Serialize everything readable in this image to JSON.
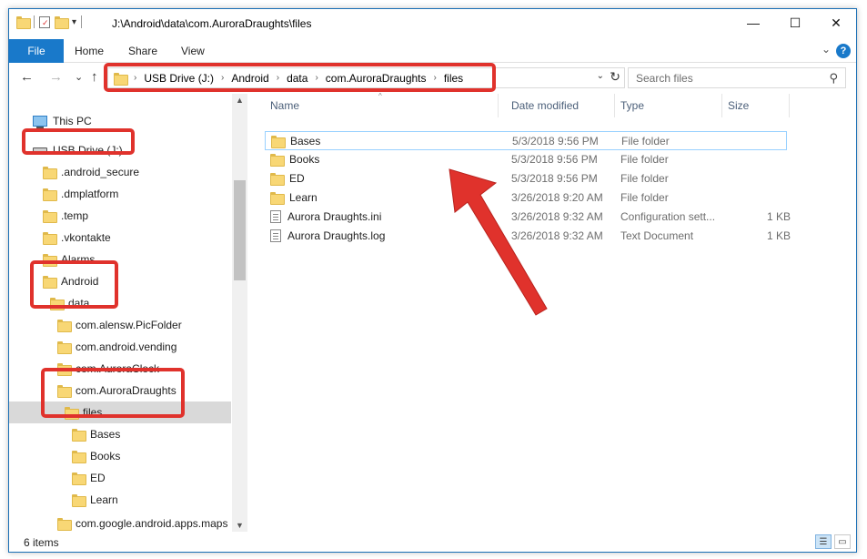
{
  "window": {
    "title": "J:\\Android\\data\\com.AuroraDraughts\\files",
    "minimize": "—",
    "maximize": "☐",
    "close": "✕"
  },
  "ribbon": {
    "tabs": [
      "File",
      "Home",
      "Share",
      "View"
    ],
    "help": "?"
  },
  "nav": {
    "back": "←",
    "forward": "→",
    "recent": "⌄",
    "up": "↑",
    "breadcrumbs": [
      "USB Drive (J:)",
      "Android",
      "data",
      "com.AuroraDraughts",
      "files"
    ],
    "search_placeholder": "Search files"
  },
  "tree": [
    {
      "label": "This PC",
      "icon": "pc-icon"
    },
    {
      "label": "USB Drive (J:)",
      "icon": "drive-icon"
    },
    {
      "label": ".android_secure",
      "icon": "folder-icon"
    },
    {
      "label": ".dmplatform",
      "icon": "folder-icon"
    },
    {
      "label": ".temp",
      "icon": "folder-icon"
    },
    {
      "label": ".vkontakte",
      "icon": "folder-icon"
    },
    {
      "label": "Alarms",
      "icon": "folder-icon"
    },
    {
      "label": "Android",
      "icon": "folder-icon"
    },
    {
      "label": "data",
      "icon": "folder-icon"
    },
    {
      "label": "com.alensw.PicFolder",
      "icon": "folder-icon"
    },
    {
      "label": "com.android.vending",
      "icon": "folder-icon"
    },
    {
      "label": "com.AuroraClock",
      "icon": "folder-icon"
    },
    {
      "label": "com.AuroraDraughts",
      "icon": "folder-icon"
    },
    {
      "label": "files",
      "icon": "folder-icon"
    },
    {
      "label": "Bases",
      "icon": "folder-icon"
    },
    {
      "label": "Books",
      "icon": "folder-icon"
    },
    {
      "label": "ED",
      "icon": "folder-icon"
    },
    {
      "label": "Learn",
      "icon": "folder-icon"
    },
    {
      "label": "com.google.android.apps.maps",
      "icon": "folder-icon"
    }
  ],
  "columns": {
    "name": "Name",
    "date": "Date modified",
    "type": "Type",
    "size": "Size"
  },
  "files": [
    {
      "name": "Bases",
      "date": "5/3/2018 9:56 PM",
      "type": "File folder",
      "size": "",
      "icon": "folder-icon"
    },
    {
      "name": "Books",
      "date": "5/3/2018 9:56 PM",
      "type": "File folder",
      "size": "",
      "icon": "folder-icon"
    },
    {
      "name": "ED",
      "date": "5/3/2018 9:56 PM",
      "type": "File folder",
      "size": "",
      "icon": "folder-icon"
    },
    {
      "name": "Learn",
      "date": "3/26/2018 9:20 AM",
      "type": "File folder",
      "size": "",
      "icon": "folder-icon"
    },
    {
      "name": "Aurora Draughts.ini",
      "date": "3/26/2018 9:32 AM",
      "type": "Configuration sett...",
      "size": "1 KB",
      "icon": "settings-file-icon"
    },
    {
      "name": "Aurora Draughts.log",
      "date": "3/26/2018 9:32 AM",
      "type": "Text Document",
      "size": "1 KB",
      "icon": "text-file-icon"
    }
  ],
  "status": {
    "item_count": "6 items"
  },
  "colors": {
    "accent": "#1979ca",
    "annotation": "#e0322c",
    "selection": "#cce8ff"
  }
}
